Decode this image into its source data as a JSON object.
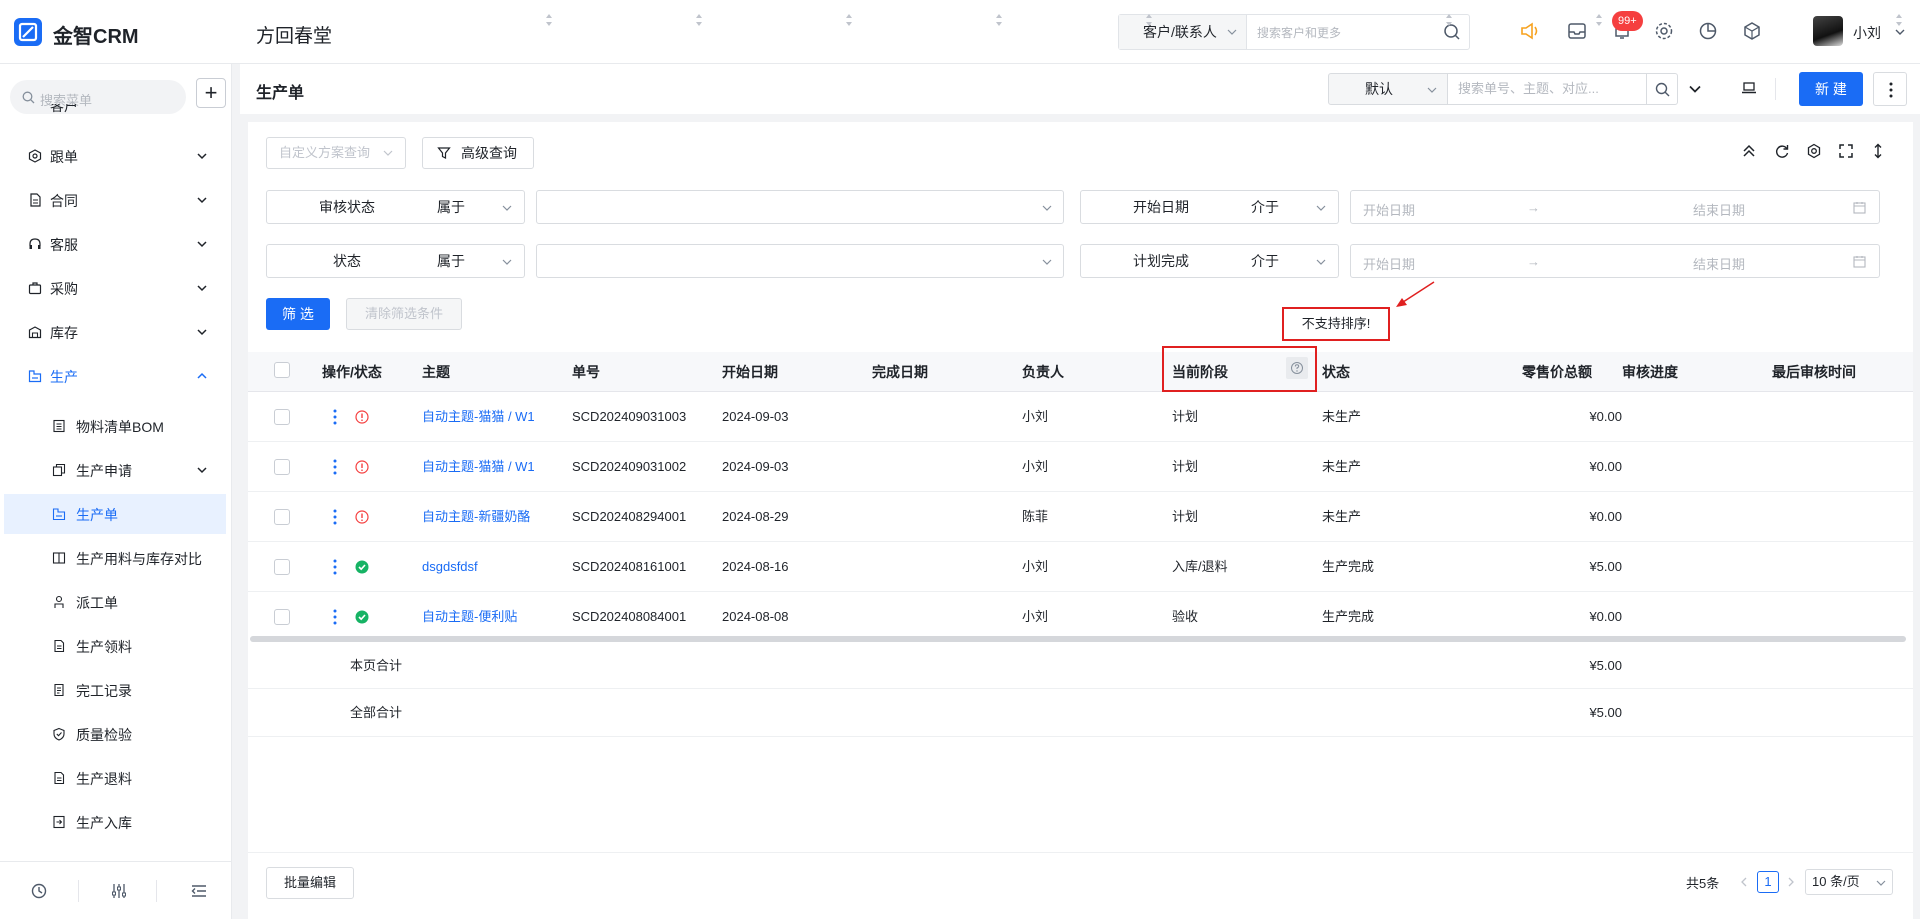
{
  "app": {
    "brand": "金智CRM",
    "company": "方回春堂"
  },
  "header": {
    "search_type": "客户/联系人",
    "search_placeholder": "搜索客户和更多",
    "badge": "99+",
    "user": "小刘"
  },
  "sidebar": {
    "search_placeholder": "搜索菜单",
    "add_label": "+",
    "partial_item": "客户",
    "items": [
      {
        "label": "跟单"
      },
      {
        "label": "合同"
      },
      {
        "label": "客服"
      },
      {
        "label": "采购"
      },
      {
        "label": "库存"
      },
      {
        "label": "生产"
      }
    ],
    "sub_items": [
      {
        "label": "物料清单BOM"
      },
      {
        "label": "生产申请"
      },
      {
        "label": "生产单"
      },
      {
        "label": "生产用料与库存对比"
      },
      {
        "label": "派工单"
      },
      {
        "label": "生产领料"
      },
      {
        "label": "完工记录"
      },
      {
        "label": "质量检验"
      },
      {
        "label": "生产退料"
      },
      {
        "label": "生产入库"
      }
    ]
  },
  "page": {
    "title": "生产单",
    "view": "默认",
    "search_placeholder": "搜索单号、主题、对应...",
    "new_label": "新 建"
  },
  "filters": {
    "custom_query_placeholder": "自定义方案查询",
    "advanced_label": "高级查询",
    "rows": [
      {
        "left_label": "审核状态",
        "left_op": "属于",
        "right_label": "开始日期",
        "right_op": "介于"
      },
      {
        "left_label": "状态",
        "left_op": "属于",
        "right_label": "计划完成",
        "right_op": "介于"
      }
    ],
    "start_placeholder": "开始日期",
    "end_placeholder": "结束日期",
    "arrow": "→",
    "filter_btn": "筛 选",
    "clear_btn": "清除筛选条件"
  },
  "tooltip": "不支持排序!",
  "table": {
    "columns": [
      "操作/状态",
      "主题",
      "单号",
      "开始日期",
      "完成日期",
      "负责人",
      "当前阶段",
      "状态",
      "零售价总额",
      "审核进度",
      "最后审核时间"
    ],
    "rows": [
      {
        "status": "warning",
        "subject": "自动主题-猫猫 / W1",
        "no": "SCD202409031003",
        "start": "2024-09-03",
        "end": "",
        "owner": "小刘",
        "stage": "计划",
        "state": "未生产",
        "amount": "¥0.00"
      },
      {
        "status": "warning",
        "subject": "自动主题-猫猫 / W1",
        "no": "SCD202409031002",
        "start": "2024-09-03",
        "end": "",
        "owner": "小刘",
        "stage": "计划",
        "state": "未生产",
        "amount": "¥0.00"
      },
      {
        "status": "warning",
        "subject": "自动主题-新疆奶酪",
        "no": "SCD202408294001",
        "start": "2024-08-29",
        "end": "",
        "owner": "陈菲",
        "stage": "计划",
        "state": "未生产",
        "amount": "¥0.00"
      },
      {
        "status": "ok",
        "subject": "dsgdsfdsf",
        "no": "SCD202408161001",
        "start": "2024-08-16",
        "end": "",
        "owner": "小刘",
        "stage": "入库/退料",
        "state": "生产完成",
        "amount": "¥5.00"
      },
      {
        "status": "ok",
        "subject": "自动主题-便利贴",
        "no": "SCD202408084001",
        "start": "2024-08-08",
        "end": "",
        "owner": "小刘",
        "stage": "验收",
        "state": "生产完成",
        "amount": "¥0.00"
      }
    ],
    "page_total_label": "本页合计",
    "page_total_value": "¥5.00",
    "all_total_label": "全部合计",
    "all_total_value": "¥5.00"
  },
  "footer": {
    "batch_edit": "批量编辑",
    "total": "共5条",
    "page": "1",
    "page_size": "10 条/页"
  },
  "colors": {
    "accent": "#1a6cf5",
    "warning": "#f53f3f",
    "ok": "#16b364",
    "annotation": "#e02020"
  }
}
